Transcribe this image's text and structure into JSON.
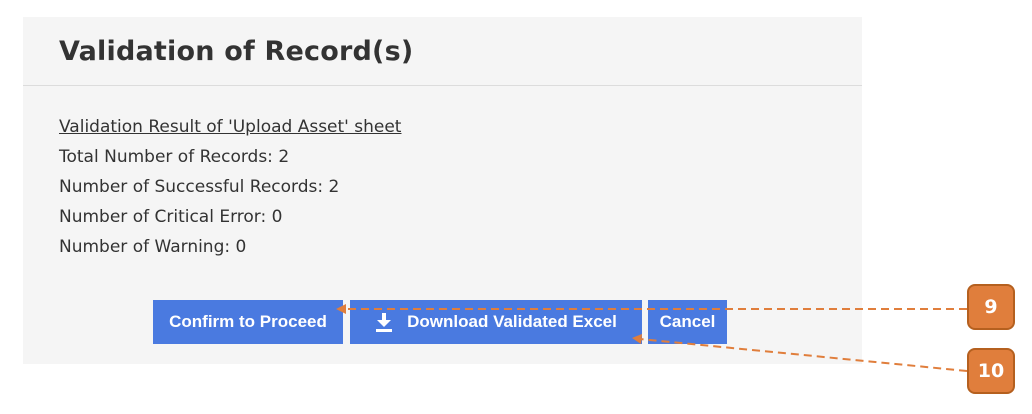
{
  "dialog": {
    "title": "Validation of Record(s)",
    "result_heading": "Validation Result of 'Upload Asset' sheet",
    "lines": [
      "Total Number of Records: 2",
      "Number of Successful Records: 2",
      "Number of Critical Error: 0",
      "Number of Warning: 0"
    ]
  },
  "buttons": {
    "confirm_label": "Confirm to Proceed",
    "download_label": "Download Validated Excel",
    "download_icon": "download-icon",
    "cancel_label": "Cancel"
  },
  "annotations": {
    "callout_9": "9",
    "callout_10": "10"
  },
  "colors": {
    "button_bg": "#4a7ae0",
    "callout_fill": "#e07e3c",
    "panel_bg": "#f5f5f5"
  }
}
